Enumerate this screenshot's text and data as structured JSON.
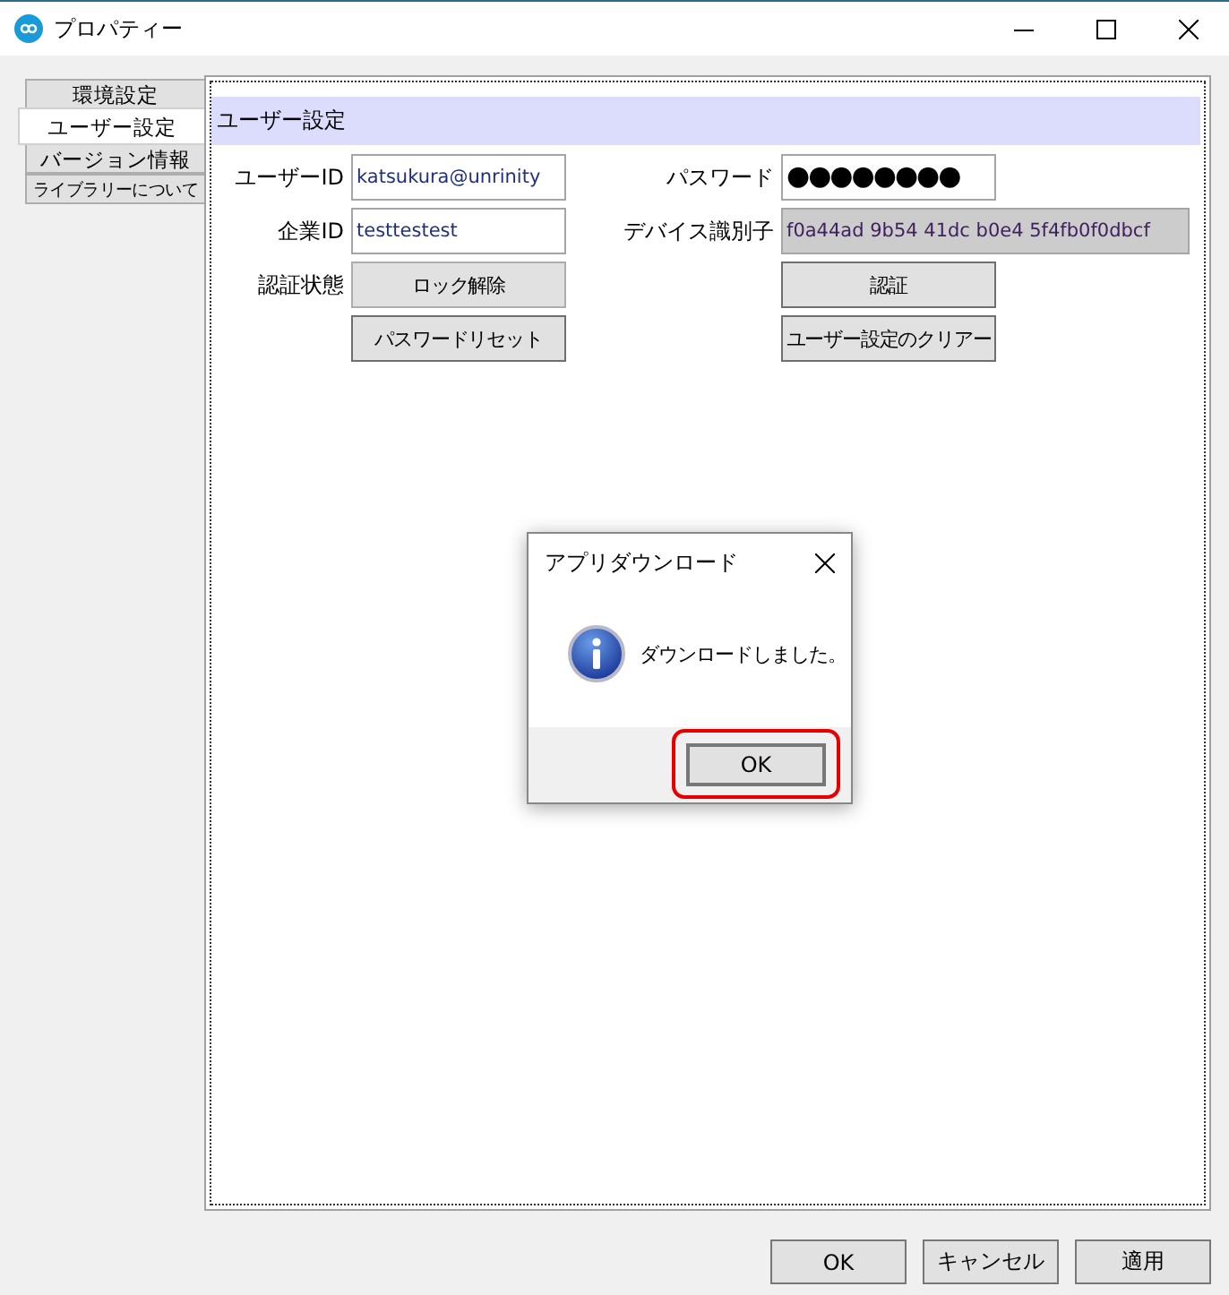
{
  "window": {
    "title": "プロパティー"
  },
  "tabs": [
    {
      "label": "環境設定",
      "selected": false
    },
    {
      "label": "ユーザー設定",
      "selected": true
    },
    {
      "label": "バージョン情報",
      "selected": false
    },
    {
      "label": "ライブラリーについて",
      "selected": false
    }
  ],
  "section": {
    "title": "ユーザー設定"
  },
  "left": [
    {
      "kind": "input",
      "label": "ユーザーID",
      "value": "katsukura@unrinity"
    },
    {
      "kind": "input",
      "label": "企業ID",
      "value": "testtestest"
    },
    {
      "kind": "status",
      "label": "認証状態",
      "value": "ロック解除"
    },
    {
      "kind": "button",
      "value": "パスワードリセット"
    }
  ],
  "right": [
    {
      "kind": "password",
      "label": "パスワード",
      "value": "●●●●●●●●"
    },
    {
      "kind": "readonly",
      "label": "デバイス識別子",
      "value": "f0a44ad 9b54 41dc b0e4 5f4fb0f0dbcf"
    },
    {
      "kind": "button",
      "value": "認証"
    },
    {
      "kind": "button",
      "value": "ユーザー設定のクリアー"
    }
  ],
  "dialog": {
    "title": "アプリダウンロード",
    "message": "ダウンロードしました。",
    "button": {
      "label": "OK",
      "highlighted": true
    }
  },
  "buttons": [
    "OK",
    "キャンセル",
    "適用"
  ]
}
